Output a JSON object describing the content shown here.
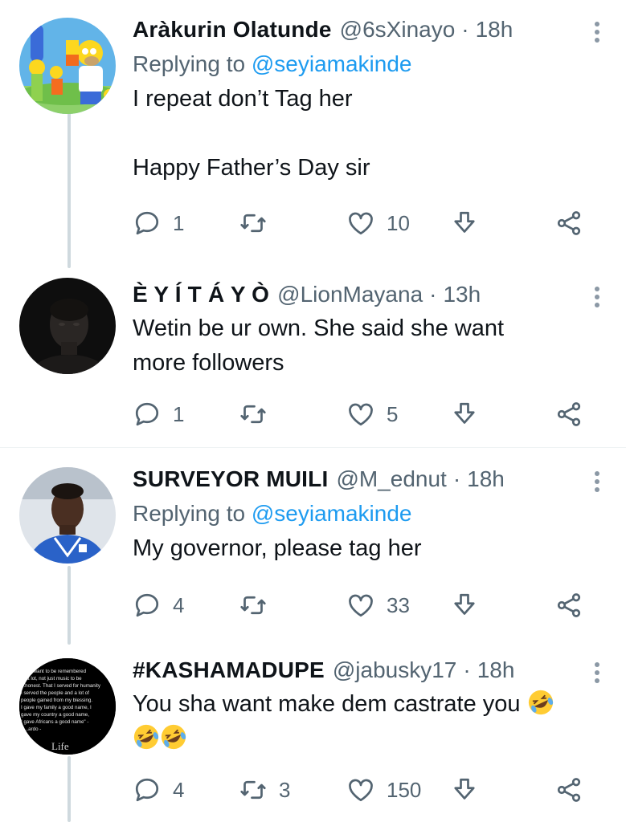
{
  "colors": {
    "accent": "#1d9bf0",
    "secondary_text": "#536471",
    "primary_text": "#0f1419",
    "thread_line": "#cfd9de"
  },
  "tweets": [
    {
      "name": "Aràkurin Olatunde",
      "handle": "@6sXinayo",
      "dot": "·",
      "time": "18h",
      "replying_prefix": "Replying to",
      "replying_to": "@seyiamakinde",
      "lines": [
        "I repeat don’t Tag her",
        "Happy Father’s Day sir"
      ],
      "replies": "1",
      "retweets": "",
      "likes": "10",
      "avatar": "cartoon-family-avatar"
    },
    {
      "name": "È Y Í T Á Y Ò",
      "handle": "@LionMayana",
      "dot": "·",
      "time": "13h",
      "lines": [
        "Wetin be ur own.  She said she want",
        "more followers"
      ],
      "replies": "1",
      "retweets": "",
      "likes": "5",
      "avatar": "dark-portrait-avatar"
    },
    {
      "name": "SURVEYOR MUILI",
      "handle": "@M_ednut",
      "dot": "·",
      "time": "18h",
      "replying_prefix": "Replying to",
      "replying_to": "@seyiamakinde",
      "lines": [
        "My governor, please tag her"
      ],
      "replies": "4",
      "retweets": "",
      "likes": "33",
      "avatar": "selfie-avatar"
    },
    {
      "name": "#KASHAMADUPE",
      "handle": "@jabusky17",
      "dot": "·",
      "time": "18h",
      "lines": [
        "You sha want make dem castrate you"
      ],
      "replies": "4",
      "retweets": "3",
      "likes": "150",
      "avatar": "quote-text-avatar",
      "avatar_quote": [
        "...ld want to be remembered",
        "...a lot, not just music to be",
        "...honest. That I served for humanity",
        "I served the people and a lot of",
        "people gained from my blessing.",
        "I gave my family a good name, I",
        "gave my country a good name,",
        "I gave Africans a good name\" -",
        "...ardo -",
        "Life"
      ],
      "emoji": "rolling-on-floor-laughing"
    }
  ]
}
